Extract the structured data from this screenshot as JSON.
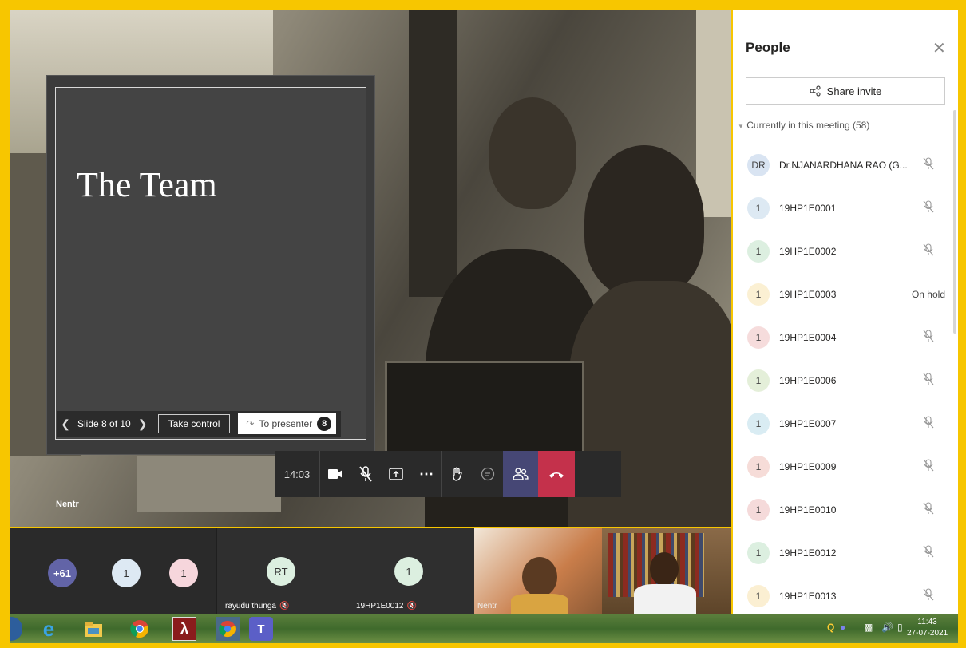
{
  "stage": {
    "presenter_name": "Nentr"
  },
  "slide": {
    "title": "The Team",
    "counter": "Slide 8 of 10",
    "take_control": "Take control",
    "to_presenter": "To presenter",
    "presenter_badge": "8"
  },
  "toolbar": {
    "timer": "14:03"
  },
  "people": {
    "title": "People",
    "share_invite": "Share invite",
    "section": "Currently in this meeting (58)",
    "list": [
      {
        "initials": "DR",
        "name": "Dr.NJANARDHANA RAO (G...",
        "color": "#d9e4f2",
        "status": ""
      },
      {
        "initials": "1",
        "name": "19HP1E0001",
        "color": "#dde9f3",
        "status": ""
      },
      {
        "initials": "1",
        "name": "19HP1E0002",
        "color": "#dcefe0",
        "status": ""
      },
      {
        "initials": "1",
        "name": "19HP1E0003",
        "color": "#fbf0d3",
        "status": "On hold"
      },
      {
        "initials": "1",
        "name": "19HP1E0004",
        "color": "#f6dcdc",
        "status": ""
      },
      {
        "initials": "1",
        "name": "19HP1E0006",
        "color": "#e4efd9",
        "status": ""
      },
      {
        "initials": "1",
        "name": "19HP1E0007",
        "color": "#d9ecf3",
        "status": ""
      },
      {
        "initials": "1",
        "name": "19HP1E0009",
        "color": "#f6dcd8",
        "status": ""
      },
      {
        "initials": "1",
        "name": "19HP1E0010",
        "color": "#f5dada",
        "status": ""
      },
      {
        "initials": "1",
        "name": "19HP1E0012",
        "color": "#dcefe0",
        "status": ""
      },
      {
        "initials": "1",
        "name": "19HP1E0013",
        "color": "#fbefd2",
        "status": ""
      }
    ]
  },
  "strip": {
    "overflow_count": "+61",
    "tile_a": "1",
    "tile_b": "1",
    "rt_initials": "RT",
    "rt_name": "rayudu thunga",
    "p12_initials": "1",
    "p12_name": "19HP1E0012",
    "video_name": "Nentr"
  },
  "taskbar": {
    "time": "11:43",
    "date": "27-07-2021"
  }
}
